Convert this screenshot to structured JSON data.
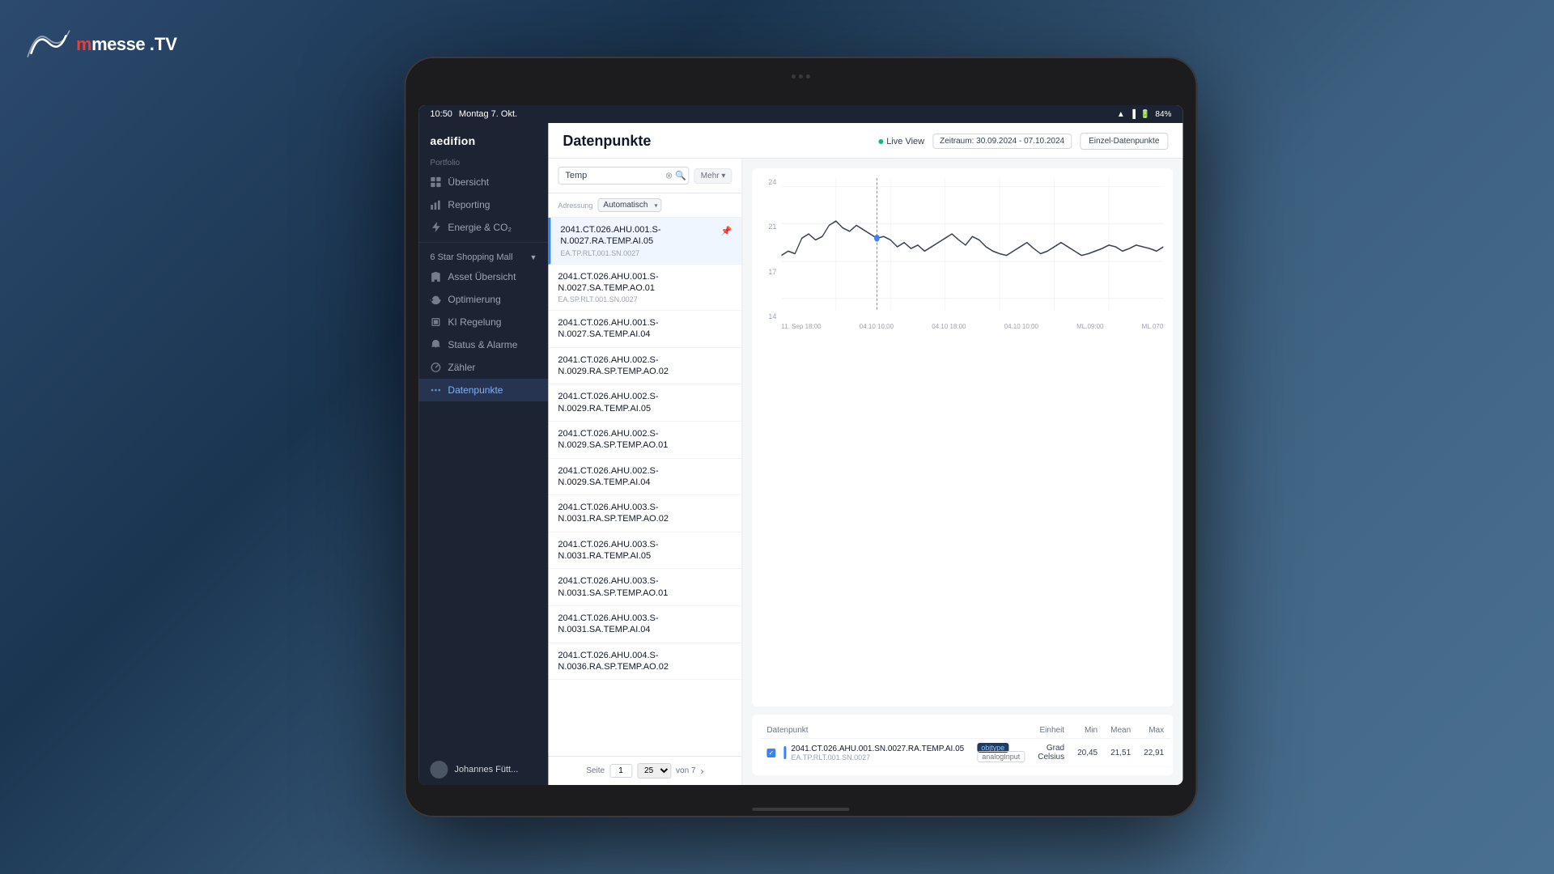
{
  "background": {
    "color": "#2c4a6e"
  },
  "logo": {
    "text": "messe",
    "suffix": ".TV"
  },
  "status_bar": {
    "time": "10:50",
    "date": "Montag 7. Okt.",
    "battery": "84%",
    "icons": "wifi signal battery"
  },
  "sidebar": {
    "brand": "aedifion",
    "portfolio_label": "Portfolio",
    "items": [
      {
        "id": "uebersicht",
        "label": "Übersicht",
        "icon": "grid"
      },
      {
        "id": "reporting",
        "label": "Reporting",
        "icon": "chart-bar"
      },
      {
        "id": "energie",
        "label": "Energie & CO₂",
        "icon": "lightning"
      }
    ],
    "group": {
      "label": "6 Star Shopping Mall",
      "items": [
        {
          "id": "asset-uebersicht",
          "label": "Asset Übersicht",
          "icon": "building"
        },
        {
          "id": "optimierung",
          "label": "Optimierung",
          "icon": "refresh"
        },
        {
          "id": "ki-regelung",
          "label": "KI Regelung",
          "icon": "cpu"
        },
        {
          "id": "status-alarme",
          "label": "Status & Alarme",
          "icon": "bell"
        },
        {
          "id": "zaehler",
          "label": "Zähler",
          "icon": "meter"
        },
        {
          "id": "datenpunkte",
          "label": "Datenpunkte",
          "icon": "dots"
        }
      ]
    }
  },
  "main": {
    "title": "Datenpunkte",
    "live_view_label": "Live View",
    "zeitraum_label": "Zeitraum: 30.09.2024 - 07.10.2024",
    "export_button": "Einzel-Datenpunkte",
    "search": {
      "placeholder": "Temp",
      "adressung_label": "Adressung",
      "adressung_value": "Automatisch"
    },
    "mehr_label": "Mehr ▾"
  },
  "data_list": {
    "items": [
      {
        "name": "2041.CT.026.AHU.001.S-N.0027.RA.TEMP.AI.05",
        "sub": "EA.TP.RLT.001.SN.0027",
        "active": true
      },
      {
        "name": "2041.CT.026.AHU.001.S-N.0027.SA.TEMP.AO.01",
        "sub": "EA.SP.RLT.001.SN.0027",
        "active": false
      },
      {
        "name": "2041.CT.026.AHU.001.S-N.0027.SA.TEMP.AI.04",
        "sub": "",
        "active": false
      },
      {
        "name": "2041.CT.026.AHU.002.S-N.0029.RA.SP.TEMP.AO.02",
        "sub": "",
        "active": false
      },
      {
        "name": "2041.CT.026.AHU.002.S-N.0029.RA.TEMP.AI.05",
        "sub": "",
        "active": false
      },
      {
        "name": "2041.CT.026.AHU.002.S-N.0029.SA.SP.TEMP.AO.01",
        "sub": "",
        "active": false
      },
      {
        "name": "2041.CT.026.AHU.002.S-N.0029.SA.TEMP.AI.04",
        "sub": "",
        "active": false
      },
      {
        "name": "2041.CT.026.AHU.003.S-N.0031.RA.SP.TEMP.AO.02",
        "sub": "",
        "active": false
      },
      {
        "name": "2041.CT.026.AHU.003.S-N.0031.RA.TEMP.AI.05",
        "sub": "",
        "active": false
      },
      {
        "name": "2041.CT.026.AHU.003.S-N.0031.SA.SP.TEMP.AO.01",
        "sub": "",
        "active": false
      },
      {
        "name": "2041.CT.026.AHU.003.S-N.0031.SA.TEMP.AI.04",
        "sub": "",
        "active": false
      },
      {
        "name": "2041.CT.026.AHU.004.S-N.0036.RA.SP.TEMP.AO.02",
        "sub": "",
        "active": false
      }
    ],
    "pagination": {
      "page_label": "Seite",
      "page_current": "1",
      "page_of": "von 7",
      "per_page": "25"
    }
  },
  "chart": {
    "y_labels": [
      "14",
      "17",
      "21",
      "24"
    ],
    "x_labels": [
      "11. Sep 18:00",
      "04.10  10:00",
      "04.10  18:00",
      "04.10  10:00",
      "ML.09:00",
      "ML.070"
    ],
    "points_label": "Datenpunkte",
    "selected_name": "2041.CT.026.AHU.001.SN.0027.RA.TEMP.AI.05",
    "selected_sub": "EA.TP.RLT.001.SN.0027"
  },
  "table": {
    "headers": [
      "Datenpunkt",
      "",
      "Einheit",
      "Min",
      "Mean",
      "Max"
    ],
    "rows": [
      {
        "checked": true,
        "color": "#3b82f6",
        "name": "2041.CT.026.AHU.001.SN.0027.RA.TEMP.AI.05",
        "sub": "EA.TP.RLT.001.SN.0027",
        "tag1": "objtype",
        "tag2": "analogInput",
        "unit": "Grad Celsius",
        "min": "20,45",
        "mean": "21,51",
        "max": "22,91"
      }
    ]
  },
  "user": {
    "name": "Johannes Fütt..."
  }
}
